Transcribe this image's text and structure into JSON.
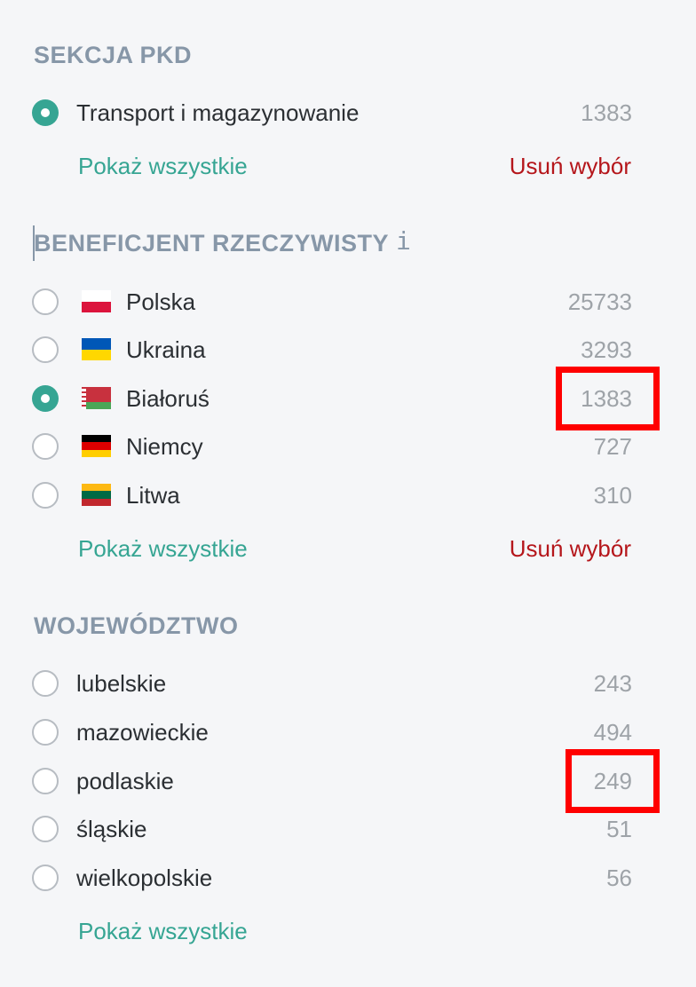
{
  "pkd": {
    "title": "SEKCJA PKD",
    "options": [
      {
        "label": "Transport i magazynowanie",
        "count": "1383",
        "checked": true
      }
    ],
    "show_all": "Pokaż wszystkie",
    "clear": "Usuń wybór"
  },
  "beneficiary": {
    "title": "BENEFICJENT RZECZYWISTY",
    "info_icon": "i",
    "options": [
      {
        "label": "Polska",
        "count": "25733",
        "checked": false,
        "flag": "poland-flag-icon"
      },
      {
        "label": "Ukraina",
        "count": "3293",
        "checked": false,
        "flag": "ukraine-flag-icon"
      },
      {
        "label": "Białoruś",
        "count": "1383",
        "checked": true,
        "flag": "belarus-flag-icon"
      },
      {
        "label": "Niemcy",
        "count": "727",
        "checked": false,
        "flag": "germany-flag-icon"
      },
      {
        "label": "Litwa",
        "count": "310",
        "checked": false,
        "flag": "lithuania-flag-icon"
      }
    ],
    "show_all": "Pokaż wszystkie",
    "clear": "Usuń wybór"
  },
  "voivodeship": {
    "title": "WOJEWÓDZTWO",
    "options": [
      {
        "label": "lubelskie",
        "count": "243",
        "checked": false
      },
      {
        "label": "mazowieckie",
        "count": "494",
        "checked": false
      },
      {
        "label": "podlaskie",
        "count": "249",
        "checked": false
      },
      {
        "label": "śląskie",
        "count": "51",
        "checked": false
      },
      {
        "label": "wielkopolskie",
        "count": "56",
        "checked": false
      }
    ],
    "show_all": "Pokaż wszystkie"
  },
  "colors": {
    "accent": "#36a593",
    "clear_link": "#b5161b",
    "heading": "#8797a8",
    "count": "#9ea3a8",
    "highlight_box": "#ff0000"
  }
}
